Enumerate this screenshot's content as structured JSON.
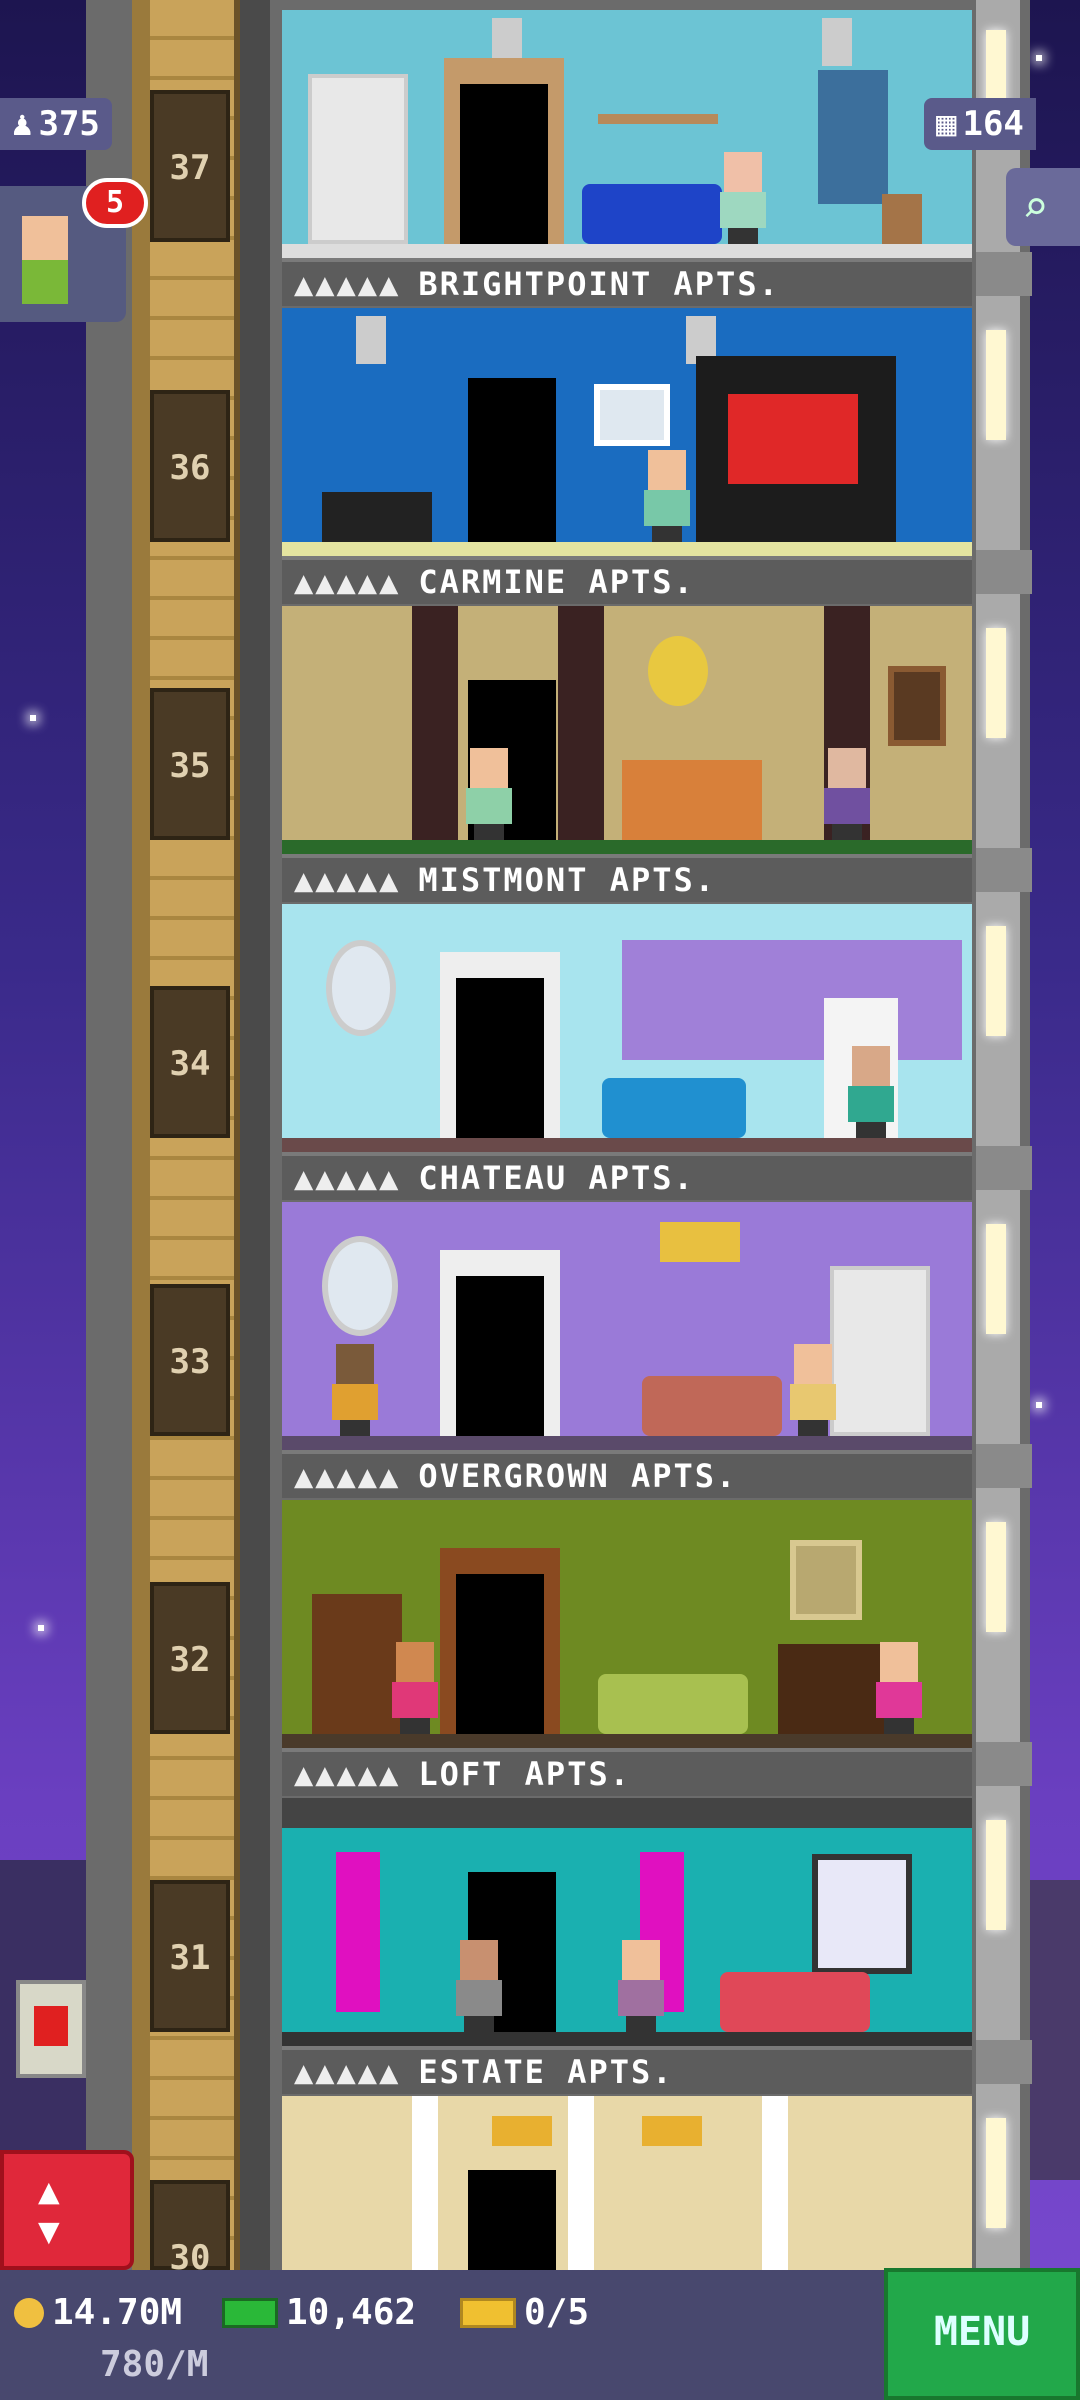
{
  "hud": {
    "population": "375",
    "bux_counter": "164",
    "notifications": "5"
  },
  "floors": [
    {
      "number": "37",
      "name": "BRIGHTPOINT APTS.",
      "dots": "▲▲▲▲▲"
    },
    {
      "number": "36",
      "name": "CARMINE APTS.",
      "dots": "▲▲▲▲▲"
    },
    {
      "number": "35",
      "name": "MISTMONT APTS.",
      "dots": "▲▲▲▲▲"
    },
    {
      "number": "34",
      "name": "CHATEAU APTS.",
      "dots": "▲▲▲▲▲"
    },
    {
      "number": "33",
      "name": "OVERGROWN APTS.",
      "dots": "▲▲▲▲▲"
    },
    {
      "number": "32",
      "name": "LOFT APTS.",
      "dots": "▲▲▲▲▲"
    },
    {
      "number": "31",
      "name": "ESTATE APTS.",
      "dots": "▲▲▲▲▲"
    },
    {
      "number": "30",
      "name": "",
      "dots": ""
    }
  ],
  "bottom": {
    "coins": "14.70M",
    "income": "780/M",
    "bux": "10,462",
    "tickets": "0/5",
    "menu_label": "MENU"
  },
  "colors": {
    "accent_green": "#22a84a",
    "elevator_red": "#e0283a",
    "badge_red": "#e02020"
  }
}
